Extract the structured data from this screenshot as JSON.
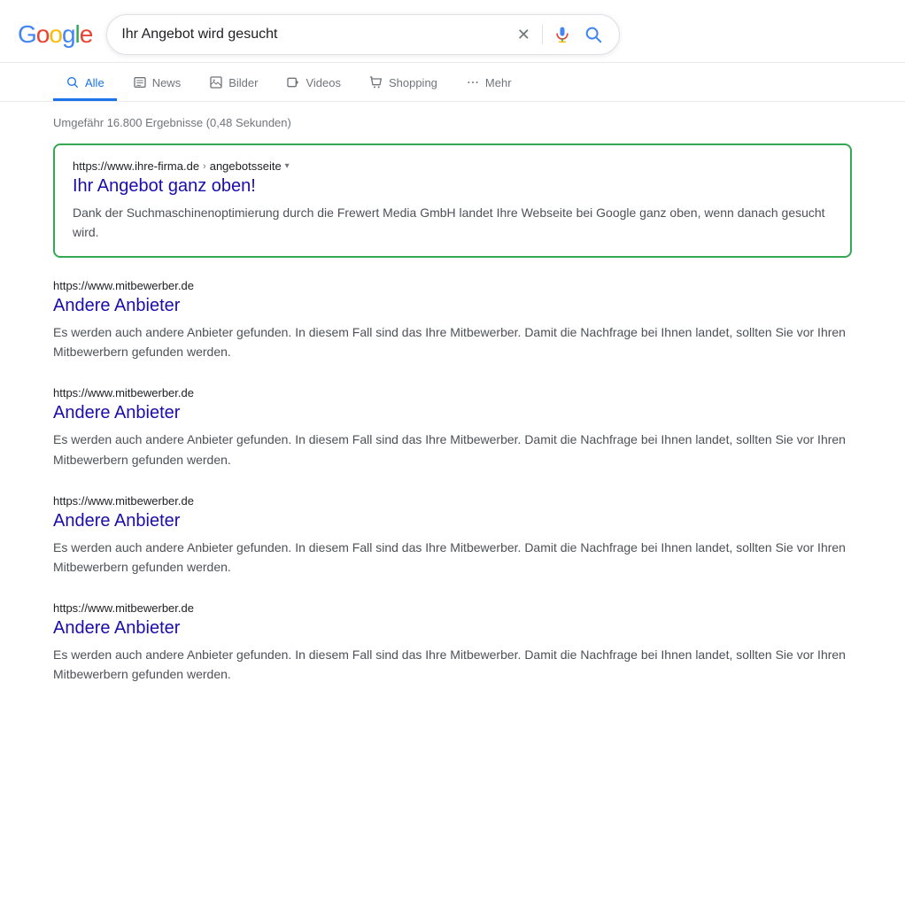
{
  "header": {
    "logo": {
      "g1": "G",
      "o1": "o",
      "o2": "o",
      "g2": "g",
      "l": "l",
      "e": "e"
    },
    "search_query": "Ihr Angebot wird gesucht",
    "clear_label": "×",
    "mic_label": "Spracheingabe",
    "search_label": "Suche"
  },
  "nav": {
    "tabs": [
      {
        "id": "alle",
        "label": "Alle",
        "active": true
      },
      {
        "id": "news",
        "label": "News",
        "active": false
      },
      {
        "id": "bilder",
        "label": "Bilder",
        "active": false
      },
      {
        "id": "videos",
        "label": "Videos",
        "active": false
      },
      {
        "id": "shopping",
        "label": "Shopping",
        "active": false
      },
      {
        "id": "mehr",
        "label": "Mehr",
        "active": false
      }
    ]
  },
  "results": {
    "count_text": "Umgefähr 16.800 Ergebnisse (0,48 Sekunden)",
    "featured": {
      "url": "https://www.ihre-firma.de",
      "breadcrumb": "angebotsseite",
      "title": "Ihr Angebot ganz oben!",
      "description": "Dank der Suchmaschinenoptimierung durch die Frewert Media GmbH landet Ihre Webseite bei Google ganz oben, wenn danach gesucht wird."
    },
    "items": [
      {
        "url": "https://www.mitbewerber.de",
        "title": "Andere Anbieter",
        "description": "Es werden auch andere Anbieter gefunden. In diesem Fall sind das Ihre Mitbewerber. Damit die Nachfrage bei Ihnen landet, sollten Sie vor Ihren Mitbewerbern gefunden werden."
      },
      {
        "url": "https://www.mitbewerber.de",
        "title": "Andere Anbieter",
        "description": "Es werden auch andere Anbieter gefunden. In diesem Fall sind das Ihre Mitbewerber. Damit die Nachfrage bei Ihnen landet, sollten Sie vor Ihren Mitbewerbern gefunden werden."
      },
      {
        "url": "https://www.mitbewerber.de",
        "title": "Andere Anbieter",
        "description": "Es werden auch andere Anbieter gefunden. In diesem Fall sind das Ihre Mitbewerber. Damit die Nachfrage bei Ihnen landet, sollten Sie vor Ihren Mitbewerbern gefunden werden."
      },
      {
        "url": "https://www.mitbewerber.de",
        "title": "Andere Anbieter",
        "description": "Es werden auch andere Anbieter gefunden. In diesem Fall sind das Ihre Mitbewerber. Damit die Nachfrage bei Ihnen landet, sollten Sie vor Ihren Mitbewerbern gefunden werden."
      }
    ]
  }
}
